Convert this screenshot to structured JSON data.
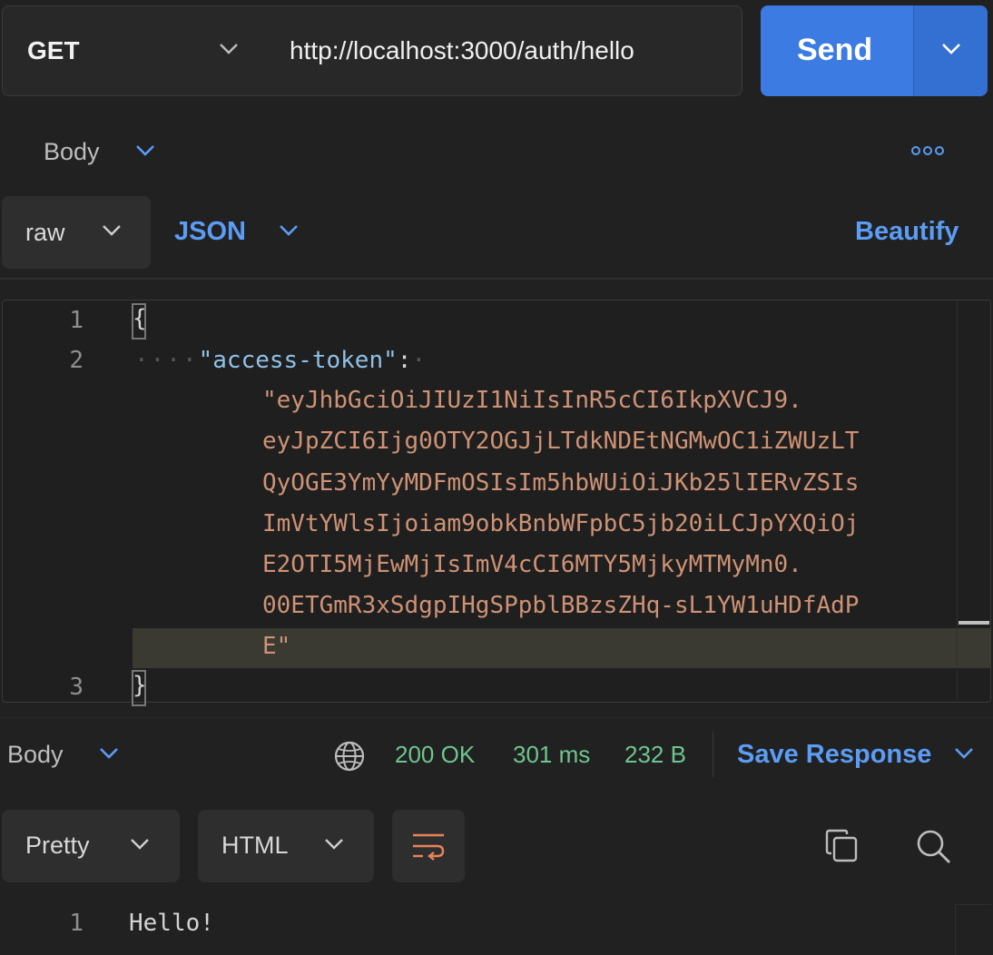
{
  "request": {
    "method": "GET",
    "url": "http://localhost:3000/auth/hello",
    "send_label": "Send"
  },
  "body_tab": {
    "label": "Body",
    "body_type": "raw",
    "language": "JSON",
    "beautify_label": "Beautify"
  },
  "editor": {
    "line_numbers": [
      "1",
      "2",
      "3"
    ],
    "open_brace": "{",
    "close_brace": "}",
    "indent_dots": "····",
    "key": "\"access-token\"",
    "colon": ":",
    "trailing_dot": "·",
    "value_lines": [
      "\"eyJhbGciOiJIUzI1NiIsInR5cCI6IkpXVCJ9.",
      "eyJpZCI6Ijg0OTY2OGJjLTdkNDEtNGMwOC1iZWUzLT",
      "QyOGE3YmYyMDFmOSIsIm5hbWUiOiJKb25lIERvZSIs",
      "ImVtYWlsIjoiam9obkBnbWFpbC5jb20iLCJpYXQiOj",
      "E2OTI5MjEwMjIsImV4cCI6MTY5MjkyMTMyMn0.",
      "00ETGmR3xSdgpIHgSPpblBBzsZHq-sL1YW1uHDfAdP",
      "E\""
    ]
  },
  "response": {
    "body_label": "Body",
    "status": "200 OK",
    "time": "301 ms",
    "size": "232 B",
    "save_label": "Save Response",
    "view_mode": "Pretty",
    "format": "HTML",
    "line_number": "1",
    "content": "Hello!"
  },
  "colors": {
    "accent": "#3c7be2",
    "link": "#5b9cf5",
    "success": "#6ec58e",
    "string": "#ce9275",
    "key": "#8fc1e8"
  },
  "icons": [
    "chevron-down-icon",
    "more-icon",
    "globe-icon",
    "wrap-icon",
    "copy-icon",
    "search-icon"
  ]
}
